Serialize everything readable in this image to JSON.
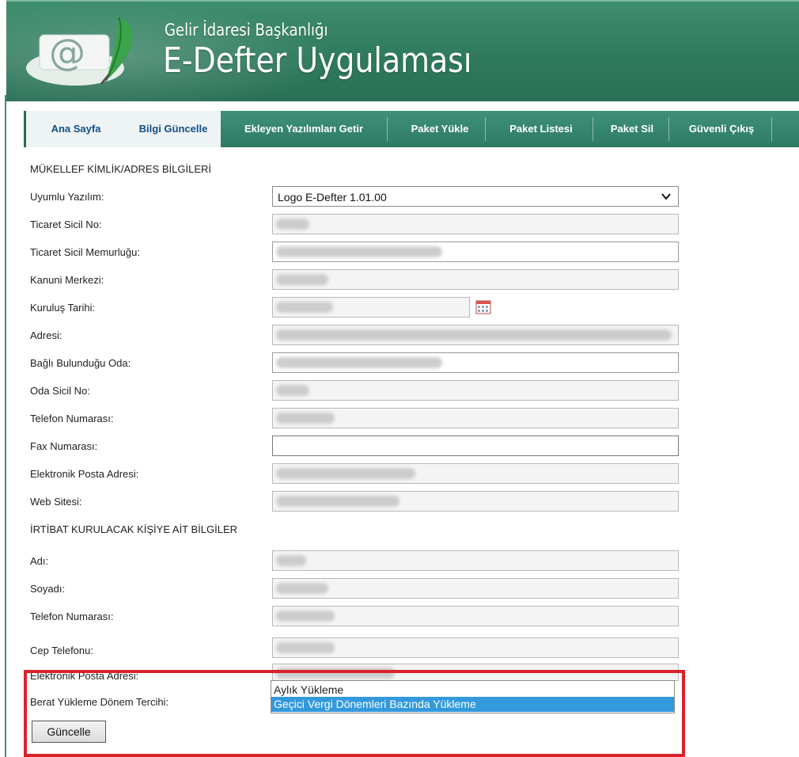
{
  "header": {
    "subtitle": "Gelir İdaresi Başkanlığı",
    "title": "E-Defter Uygulaması"
  },
  "nav": [
    {
      "label": "Ana Sayfa"
    },
    {
      "label": "Bilgi Güncelle"
    },
    {
      "label": "Ekleyen Yazılımları Getir"
    },
    {
      "label": "Paket Yükle"
    },
    {
      "label": "Paket Listesi"
    },
    {
      "label": "Paket Sil"
    },
    {
      "label": "Güvenli Çıkış"
    }
  ],
  "form": {
    "section1_title": "MÜKELLEF KİMLİK/ADRES BİLGİLERİ",
    "uyumlu_yazilim": {
      "label": "Uyumlu Yazılım:",
      "value": "Logo E-Defter 1.01.00"
    },
    "ticaret_sicil_no": {
      "label": "Ticaret Sicil No:"
    },
    "ticaret_sicil_memurlugu": {
      "label": "Ticaret Sicil Memurluğu:"
    },
    "kanuni_merkezi": {
      "label": "Kanuni Merkezi:"
    },
    "kurulus_tarihi": {
      "label": "Kuruluş Tarihi:"
    },
    "adresi": {
      "label": "Adresi:"
    },
    "bagli_oda": {
      "label": "Bağlı Bulunduğu Oda:"
    },
    "oda_sicil_no": {
      "label": "Oda Sicil No:"
    },
    "telefon": {
      "label": "Telefon Numarası:"
    },
    "fax": {
      "label": "Fax Numarası:"
    },
    "eposta": {
      "label": "Elektronik Posta Adresi:"
    },
    "web": {
      "label": "Web Sitesi:"
    },
    "section2_title": "İRTİBAT KURULACAK KİŞİYE AİT BİLGİLER",
    "adi": {
      "label": "Adı:"
    },
    "soyadi": {
      "label": "Soyadı:"
    },
    "kisi_telefon": {
      "label": "Telefon Numarası:"
    },
    "cep_telefonu": {
      "label": "Cep Telefonu:"
    },
    "kisi_eposta": {
      "label": "Elektronik Posta Adresi:"
    },
    "berat_donem": {
      "label": "Berat Yükleme Dönem Tercihi:",
      "options": [
        "Aylık Yükleme",
        "Geçici Vergi Dönemleri Bazında Yükleme"
      ],
      "selected": "Geçici Vergi Dönemleri Bazında Yükleme"
    },
    "submit_label": "Güncelle"
  },
  "colors": {
    "header_green": "#2f7a5d",
    "nav_active_text": "#134f8a",
    "selected_option": "#3399dd",
    "highlight": "#d9232b"
  }
}
